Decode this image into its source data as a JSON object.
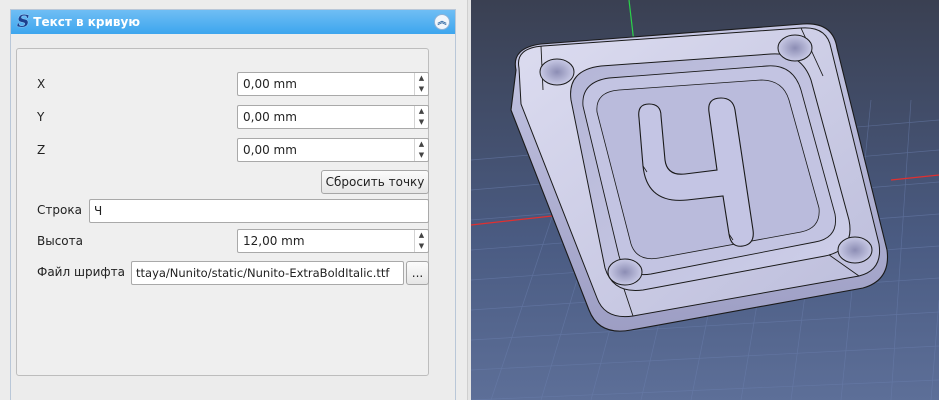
{
  "panel": {
    "logo_glyph": "S",
    "title": "Текст в кривую",
    "collapse_icon": "double-chevron-up-icon"
  },
  "fields": {
    "x": {
      "label": "X",
      "value": "0,00 mm"
    },
    "y": {
      "label": "Y",
      "value": "0,00 mm"
    },
    "z": {
      "label": "Z",
      "value": "0,00 mm"
    },
    "reset_button": "Сбросить точку",
    "string": {
      "label": "Строка",
      "value": "Ч"
    },
    "height": {
      "label": "Высота",
      "value": "12,00 mm"
    },
    "font_file": {
      "label": "Файл шрифта",
      "value": "ttaya/Nunito/static/Nunito-ExtraBoldItalic.ttf"
    },
    "browse_button": "..."
  },
  "viewport": {
    "background_colors": [
      "#3a4052",
      "#5d6f98"
    ],
    "model_color": "#c8c9e6",
    "embossed_letter": "Ч"
  }
}
